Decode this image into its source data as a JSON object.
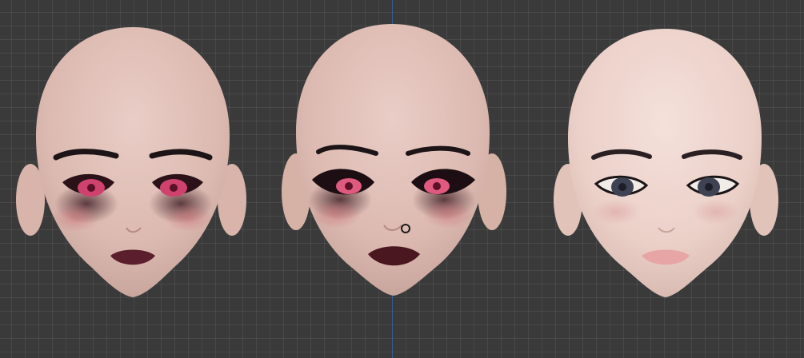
{
  "viewport": {
    "background": "#3a3a3a",
    "grid_visible": true,
    "axis_line_color": "#3a5a8f"
  },
  "heads": [
    {
      "style": "pale head, dark smoky eye makeup, pink eyes, dark lips",
      "eye_color": "#d0426e",
      "lip_color": "#5a1e2c",
      "skin": "#e3c2b9"
    },
    {
      "style": "pale head, heavy dark lashes, pink eyes, nose ring, dark lips",
      "eye_color": "#e05a80",
      "lip_color": "#4a1620",
      "skin": "#e2c0b5",
      "accessory": "nose-ring"
    },
    {
      "style": "pale head, natural makeup, gray-blue eyes, pink lips",
      "eye_color": "#3f4252",
      "lip_color": "#e7a5a5",
      "skin": "#f0d6cf"
    }
  ]
}
